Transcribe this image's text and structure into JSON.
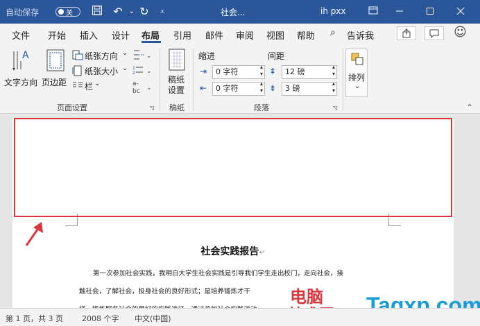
{
  "titlebar": {
    "autosave": "自动保存",
    "toggle": "关",
    "doc_title": "社会...",
    "user": "ih pxx"
  },
  "tabs": [
    "文件",
    "开始",
    "插入",
    "设计",
    "布局",
    "引用",
    "邮件",
    "审阅",
    "视图",
    "帮助",
    "告诉我"
  ],
  "ribbon": {
    "text_direction": "文字方向",
    "margins": "页边距",
    "orientation": "纸张方向",
    "size": "纸张大小",
    "columns": "栏",
    "manuscript": "稿纸",
    "manuscript_setup_1": "稿纸",
    "manuscript_setup_2": "设置",
    "indent": "缩进",
    "spacing": "间距",
    "indent_left": "0 字符",
    "indent_right": "0 字符",
    "space_before": "12 磅",
    "space_after": "3 磅",
    "arrange": "排列",
    "group_page_setup": "页面设置",
    "group_manuscript": "稿纸",
    "group_paragraph": "段落"
  },
  "document": {
    "title": "社会实践报告",
    "para1": "第一次参加社会实践，我明白大学生社会实践是引导我们学生走出校门，走向社会，接",
    "para2": "触社会，了解社会，投身社会的良好形式；是培养锻炼才干",
    "para3": "择，锻炼服务社会的最好的实践途径。通过参加社会实践活动"
  },
  "status": {
    "page": "第 1 页，共 3 页",
    "words": "2008 个字",
    "lang": "中文(中国)"
  },
  "watermark": {
    "a": "电脑",
    "b": "技术网",
    "c": "Tagxp.com"
  }
}
